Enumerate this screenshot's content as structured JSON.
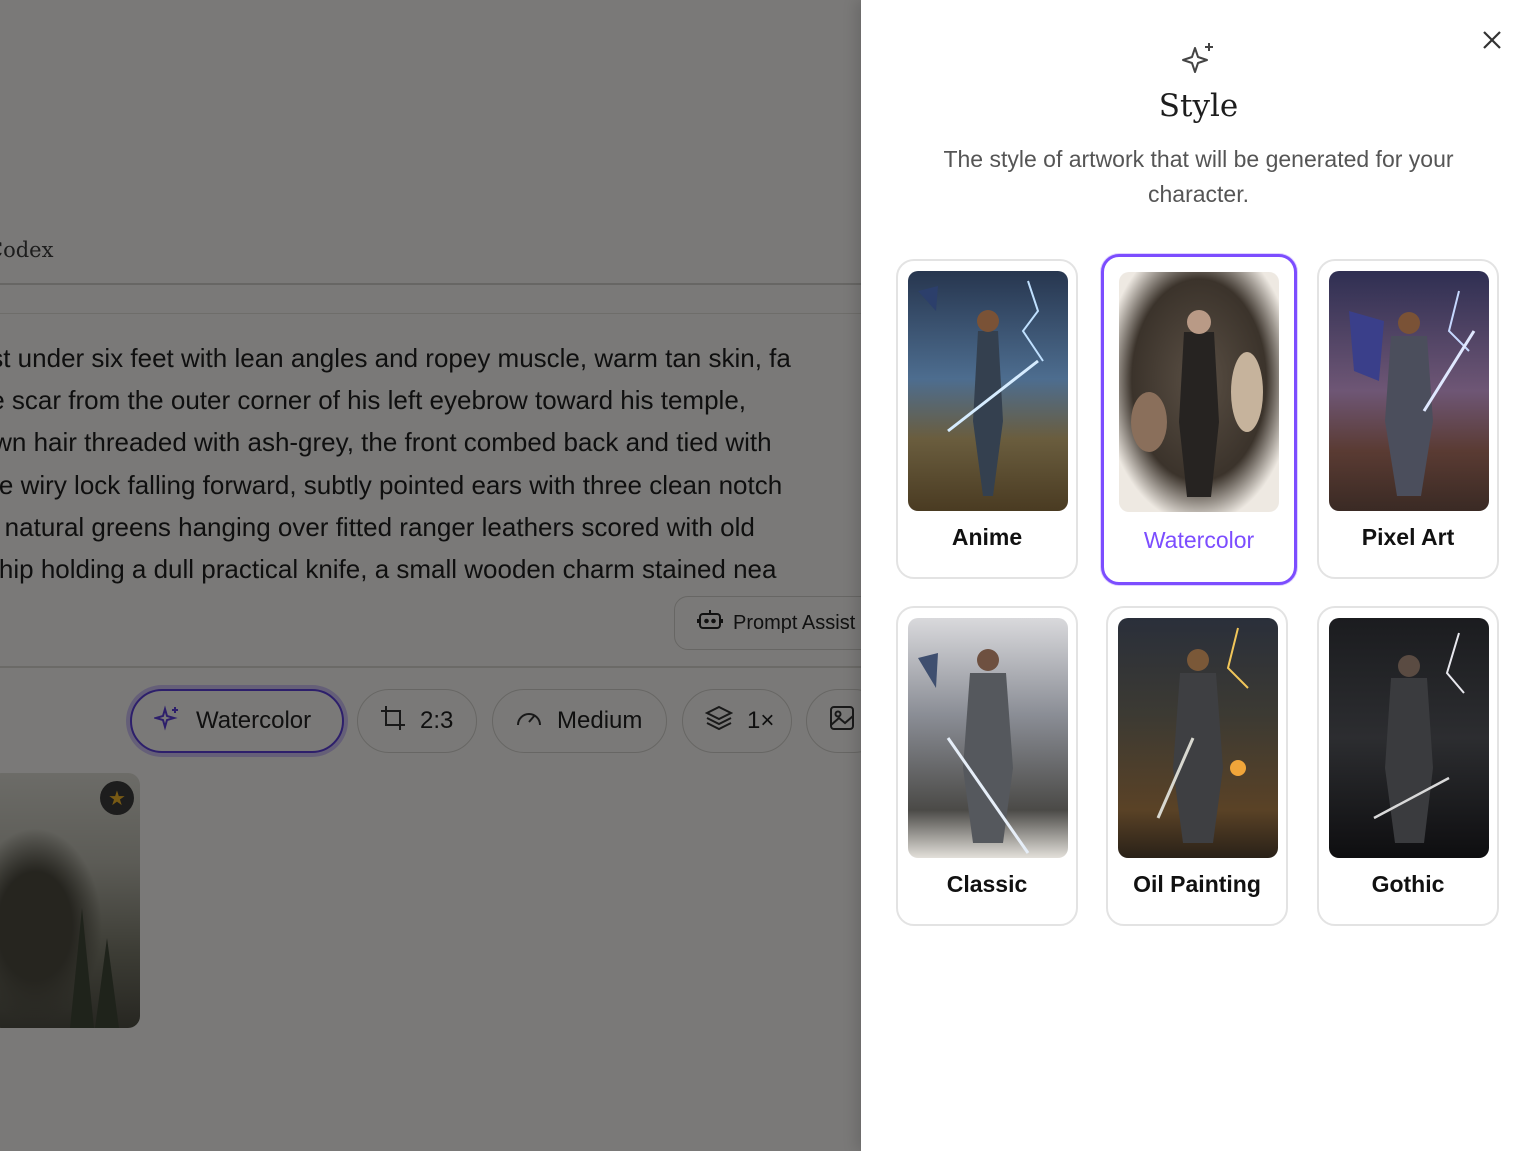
{
  "background": {
    "tab_label": "Codex",
    "prompt_lines": [
      "just under six feet with lean angles and ropey muscle, warm tan skin, fa",
      "ale scar from the outer corner of his left eyebrow toward his temple,",
      "rown hair threaded with ash-grey, the front combed back and tied with",
      "one wiry lock falling forward, subtly pointed ears with three clean notch",
      "ny natural greens hanging over fitted ranger leathers scored with old",
      "ht hip holding a dull practical knife, a small wooden charm stained nea"
    ],
    "prompt_assist_label": "Prompt Assist",
    "options": {
      "style": "Watercolor",
      "aspect": "2:3",
      "quality": "Medium",
      "count": "1×"
    }
  },
  "panel": {
    "title": "Style",
    "description": "The style of artwork that will be generated for your character.",
    "selected": "Watercolor",
    "styles": [
      {
        "label": "Anime"
      },
      {
        "label": "Watercolor"
      },
      {
        "label": "Pixel Art"
      },
      {
        "label": "Classic"
      },
      {
        "label": "Oil Painting"
      },
      {
        "label": "Gothic"
      }
    ]
  },
  "colors": {
    "accent": "#7c4dff",
    "accent_dark": "#5b3fd6",
    "overlay": "rgba(0,0,0,0.5)"
  }
}
